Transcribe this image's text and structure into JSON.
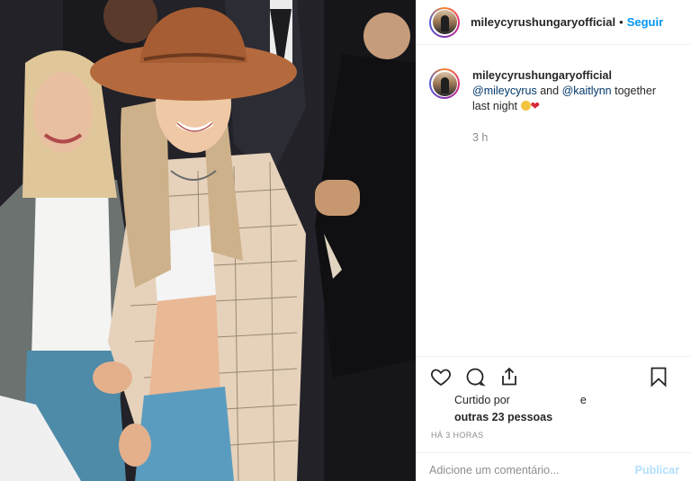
{
  "post": {
    "username": "mileycyrushungaryofficial",
    "separator": "•",
    "follow_label": "Seguir"
  },
  "caption": {
    "username": "mileycyrushungaryofficial",
    "mention_1": "@mileycyrus",
    "connector": "and",
    "mention_2": "@kaitlynn",
    "text_1": "together",
    "text_2": "last night",
    "heart": "❤",
    "time": "3 h"
  },
  "actions": {
    "like_icon": "heart-icon",
    "comment_icon": "comment-icon",
    "share_icon": "share-icon",
    "save_icon": "bookmark-icon"
  },
  "likes": {
    "prefix": "Curtido por",
    "conjunction": "e",
    "others": "outras 23 pessoas"
  },
  "posted_ago": "HÁ 3 HORAS",
  "comment": {
    "placeholder": "Adicione um comentário...",
    "publish_label": "Publicar"
  },
  "colors": {
    "accent": "#0095f6",
    "publish_disabled": "#b2dffc",
    "muted": "#8e8e8e",
    "heart": "#d6283b"
  }
}
